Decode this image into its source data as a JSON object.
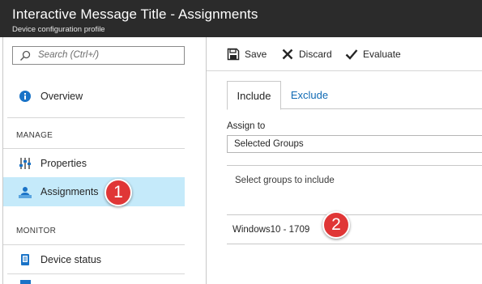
{
  "window": {
    "title": "Interactive Message Title - Assignments",
    "subtitle": "Device configuration profile"
  },
  "sidebar": {
    "search_placeholder": "Search (Ctrl+/)",
    "overview_label": "Overview",
    "manage_section": "MANAGE",
    "properties_label": "Properties",
    "assignments_label": "Assignments",
    "monitor_section": "MONITOR",
    "device_status_label": "Device status"
  },
  "toolbar": {
    "save_label": "Save",
    "discard_label": "Discard",
    "evaluate_label": "Evaluate"
  },
  "tabs": {
    "include_label": "Include",
    "exclude_label": "Exclude"
  },
  "assign": {
    "label": "Assign to",
    "selected_value": "Selected Groups",
    "hint": "Select groups to include",
    "groups": [
      "Windows10 - 1709"
    ]
  },
  "callouts": {
    "first": "1",
    "second": "2"
  },
  "colors": {
    "titlebar": "#2b2b2b",
    "selected_nav": "#c5eafa",
    "link_blue": "#0f6ab4",
    "callout_red": "#e03636"
  }
}
